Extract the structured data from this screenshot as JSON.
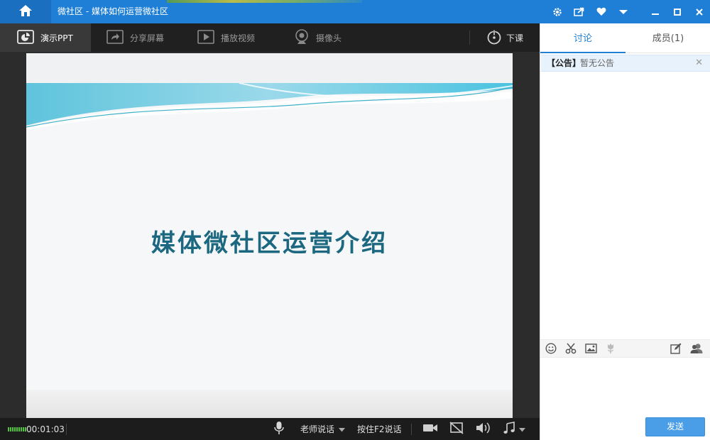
{
  "window": {
    "title": "微社区 - 媒体如何运营微社区"
  },
  "titlebar": {
    "icons": [
      "settings-icon",
      "share-icon",
      "heart-icon",
      "dropdown-icon",
      "minimize-icon",
      "maximize-icon",
      "close-icon"
    ]
  },
  "toolbar": {
    "items": [
      {
        "label": "演示PPT",
        "icon": "ppt-icon",
        "active": true
      },
      {
        "label": "分享屏幕",
        "icon": "share-screen-icon",
        "active": false
      },
      {
        "label": "播放视频",
        "icon": "play-video-icon",
        "active": false
      },
      {
        "label": "摄像头",
        "icon": "webcam-icon",
        "active": false
      }
    ],
    "end_class_label": "下课"
  },
  "slide": {
    "title": "媒体微社区运营介绍"
  },
  "statusbar": {
    "timer": "00:01:03",
    "speaker_mode": "老师说话",
    "push_to_talk": "按住F2说话"
  },
  "panel": {
    "tabs": [
      {
        "label": "讨论",
        "active": true
      },
      {
        "label": "成员(1)",
        "active": false
      }
    ],
    "notice_label": "【公告】",
    "notice_text": "暂无公告",
    "send_label": "发送"
  },
  "colors": {
    "titlebar": "#1f7fd6",
    "accent": "#1f7fd6",
    "slide_title": "#1b6880",
    "send_button": "#4a9ee8"
  }
}
